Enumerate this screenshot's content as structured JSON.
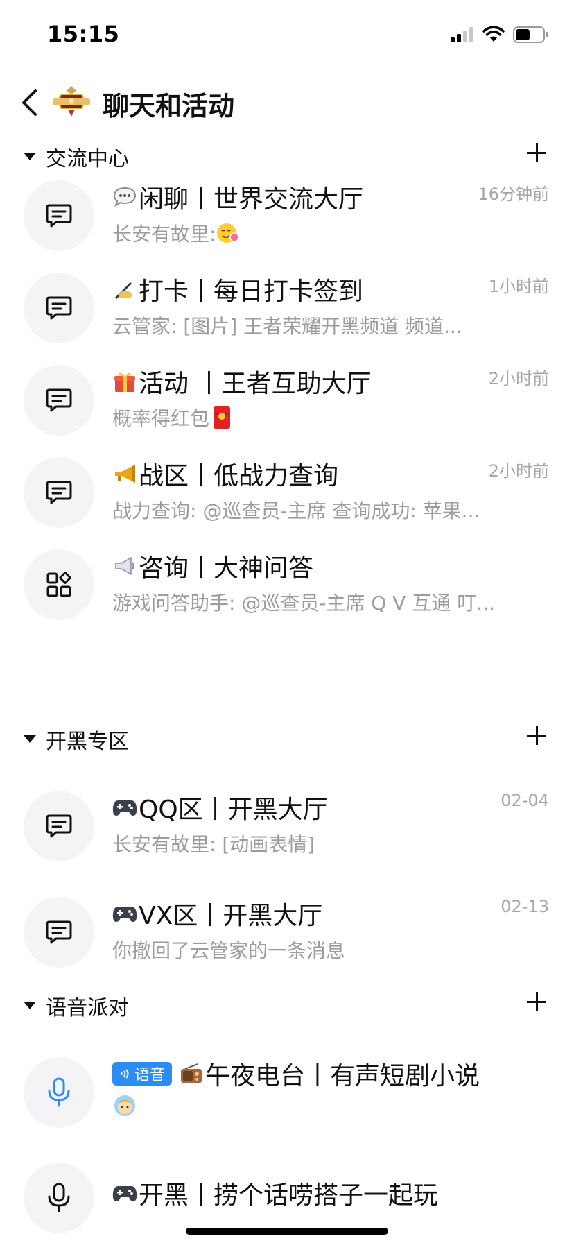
{
  "status_bar": {
    "time": "15:15"
  },
  "nav": {
    "title": "聊天和活动"
  },
  "sections": [
    {
      "title": "交流中心",
      "channels": [
        {
          "icon": "chat-bubble-icon",
          "emoji": "speech-bubble",
          "name": "闲聊丨世界交流大厅",
          "time": "16分钟前",
          "preview": "长安有故里: "
        },
        {
          "icon": "chat-bubble-icon",
          "emoji": "writing-hand",
          "name": "打卡丨每日打卡签到",
          "time": "1小时前",
          "preview": "云管家: [图片]     王者荣耀开黑频道 频道..."
        },
        {
          "icon": "chat-bubble-icon",
          "emoji": "gift",
          "name": "活动 丨王者互助大厅",
          "time": "2小时前",
          "preview": "概率得红包 "
        },
        {
          "icon": "chat-bubble-icon",
          "emoji": "horn",
          "name": "战区丨低战力查询",
          "time": "2小时前",
          "preview": "战力查询: @巡查员-主席    查询成功: 苹果..."
        },
        {
          "icon": "apps-grid-icon",
          "emoji": "megaphone",
          "name": "咨询丨大神问答",
          "time": "",
          "preview": "游戏问答助手: @巡查员-主席  Q V 互通   叮..."
        }
      ]
    },
    {
      "title": "开黑专区",
      "channels": [
        {
          "icon": "chat-bubble-icon",
          "emoji": "game-controller",
          "name": "QQ区丨开黑大厅",
          "time": "02-04",
          "preview": "长安有故里: [动画表情]"
        },
        {
          "icon": "chat-bubble-icon",
          "emoji": "game-controller",
          "name": "VX区丨开黑大厅",
          "time": "02-13",
          "preview": "你撤回了云管家的一条消息"
        }
      ]
    },
    {
      "title": "语音派对",
      "channels": [
        {
          "icon": "microphone-icon",
          "badge": "语音",
          "emoji": "radio",
          "name": "午夜电台丨有声短剧小说",
          "time": "",
          "preview": ""
        },
        {
          "icon": "microphone-icon",
          "emoji": "game-controller",
          "name": "开黑丨捞个话唠搭子一起玩",
          "time": "",
          "preview": ""
        }
      ]
    }
  ],
  "colors": {
    "accent": "#2b8cf5",
    "muted": "#9b9ba1",
    "avatar_bg": "#f4f4f6"
  }
}
